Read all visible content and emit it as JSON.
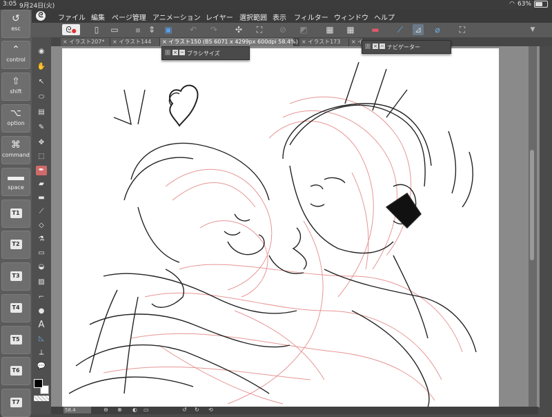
{
  "status": {
    "time": "3:05",
    "date": "9月24日(火)",
    "battery": "63%",
    "battery_level": 0.63
  },
  "keys": [
    {
      "icon": "undo-icon",
      "glyph": "↺",
      "label": "esc"
    },
    {
      "icon": "chevron-up-icon",
      "glyph": "⌃",
      "label": "control"
    },
    {
      "icon": "shift-icon",
      "glyph": "⇧",
      "label": "shift"
    },
    {
      "icon": "option-icon",
      "glyph": "⌥",
      "label": "option"
    },
    {
      "icon": "command-icon",
      "glyph": "⌘",
      "label": "command"
    },
    {
      "icon": "space-icon",
      "glyph": "",
      "label": "space"
    },
    {
      "label": "T1"
    },
    {
      "label": "T2"
    },
    {
      "label": "T3"
    },
    {
      "label": "T4"
    },
    {
      "label": "T5"
    },
    {
      "label": "T6"
    },
    {
      "label": "T7"
    }
  ],
  "menu": [
    "ファイル",
    "編集",
    "ページ管理",
    "アニメーション",
    "レイヤー",
    "選択範囲",
    "表示",
    "フィルター",
    "ウィンドウ",
    "ヘルプ"
  ],
  "tabs": [
    {
      "label": "イラスト207*",
      "active": false
    },
    {
      "label": "イラスト144",
      "active": false
    },
    {
      "label": "イラスト150 (B5 6071 x 4299px 600dpi 58.4%)",
      "active": true
    },
    {
      "label": "イラスト173",
      "active": false
    },
    {
      "label": "イ",
      "active": false
    }
  ],
  "palettes": {
    "brush_size": "ブラシサイズ",
    "navigator": "ナビゲーター"
  },
  "bottom": {
    "zoom": "58.4"
  },
  "colors": {
    "main": "#000000",
    "sub": "#ffffff",
    "accent_tool": "#d06a6a",
    "sketch_red": "#e58a8a"
  }
}
